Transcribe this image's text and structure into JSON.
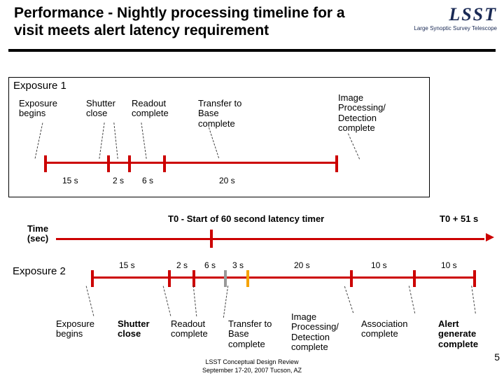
{
  "title": "Performance - Nightly processing timeline for a visit meets alert latency requirement",
  "logo": {
    "name": "LSST",
    "sub": "Large Synoptic Survey Telescope"
  },
  "pageNumber": "5",
  "footer1": "LSST Conceptual Design Review",
  "footer2": "September 17-20, 2007  Tucson, AZ",
  "timeAxisLabel": "Time (sec)",
  "t0Label": "T0 - Start of 60 second latency timer",
  "t0PlusLabel": "T0 + 51 s",
  "exposure1": {
    "heading": "Exposure 1",
    "events": {
      "begin": "Exposure begins",
      "shutter": "Shutter close",
      "readout": "Readout complete",
      "transfer": "Transfer to Base complete",
      "image": "Image Processing/ Detection complete"
    },
    "durations": {
      "d1": "15 s",
      "d2": "2 s",
      "d3": "6 s",
      "d4": "20 s"
    }
  },
  "exposure2": {
    "heading": "Exposure 2",
    "events": {
      "begin": "Exposure begins",
      "shutter": "Shutter close",
      "readout": "Readout complete",
      "transfer": "Transfer to Base complete",
      "image": "Image Processing/ Detection complete",
      "assoc": "Association complete",
      "alert": "Alert generate complete"
    },
    "durations": {
      "d1": "15 s",
      "d2": "2 s",
      "d3": "6 s",
      "d4": "3 s",
      "d5": "20 s",
      "d6": "10 s",
      "d7": "10 s"
    }
  }
}
